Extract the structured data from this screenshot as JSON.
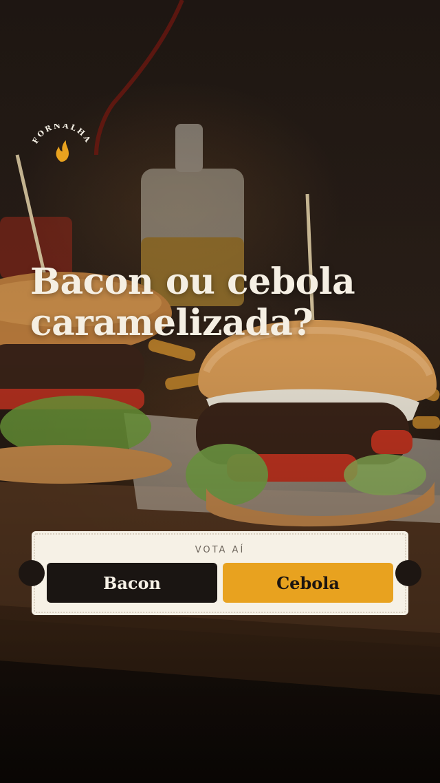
{
  "brand": {
    "name": "FORNALHA",
    "flame_color": "#e8a21f"
  },
  "headline": {
    "line1": "Bacon ou cebola",
    "line2": "caramelizada?"
  },
  "poll": {
    "label": "VOTA AÍ",
    "options": [
      {
        "label": "Bacon",
        "color": "#1a1512"
      },
      {
        "label": "Cebola",
        "color": "#e8a21f"
      }
    ]
  }
}
